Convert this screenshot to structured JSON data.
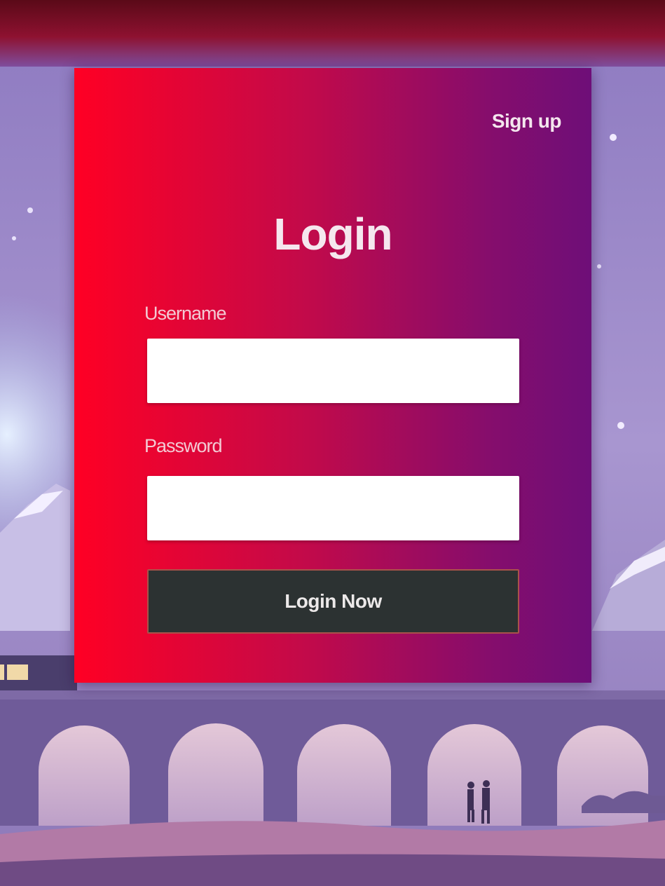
{
  "login_form": {
    "signup_link": "Sign up",
    "title": "Login",
    "username_label": "Username",
    "username_value": "",
    "password_label": "Password",
    "password_value": "",
    "submit_label": "Login Now"
  },
  "colors": {
    "card_gradient_start": "#ff0024",
    "card_gradient_end": "#6e0e78",
    "button_background": "#2c3232",
    "button_border": "#a9524a",
    "background": "#9a86c4"
  }
}
